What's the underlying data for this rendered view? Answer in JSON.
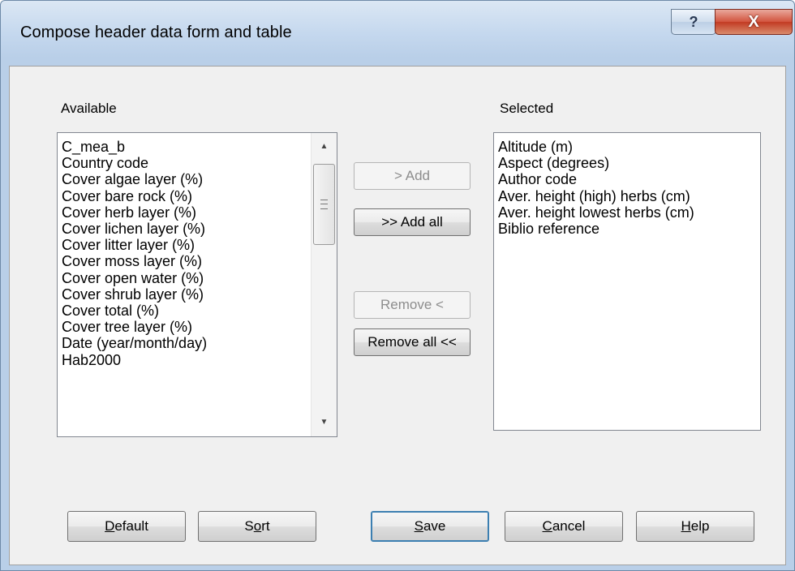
{
  "window": {
    "title": "Compose header data form and table",
    "help_glyph": "?",
    "close_glyph": "X"
  },
  "available": {
    "label": "Available",
    "items": [
      "C_mea_b",
      "Country code",
      "Cover algae layer (%)",
      "Cover bare rock (%)",
      "Cover herb layer (%)",
      "Cover lichen layer (%)",
      "Cover litter layer (%)",
      "Cover moss layer (%)",
      "Cover open water (%)",
      "Cover shrub layer (%)",
      "Cover total (%)",
      "Cover tree layer (%)",
      "Date (year/month/day)",
      "Hab2000"
    ]
  },
  "selected": {
    "label": "Selected",
    "items": [
      "Altitude (m)",
      "Aspect (degrees)",
      "Author code",
      "Aver. height (high) herbs (cm)",
      "Aver. height lowest herbs (cm)",
      "Biblio reference"
    ]
  },
  "middle_buttons": {
    "add": "> Add",
    "add_all": ">> Add all",
    "remove": "Remove <",
    "remove_all": "Remove all <<"
  },
  "bottom_buttons": {
    "default": {
      "mnemonic": "D",
      "rest": "efault"
    },
    "sort": {
      "pre": "S",
      "mnemonic": "o",
      "rest": "rt"
    },
    "save": {
      "mnemonic": "S",
      "rest": "ave"
    },
    "cancel": {
      "mnemonic": "C",
      "rest": "ancel"
    },
    "help": {
      "mnemonic": "H",
      "rest": "elp"
    }
  }
}
